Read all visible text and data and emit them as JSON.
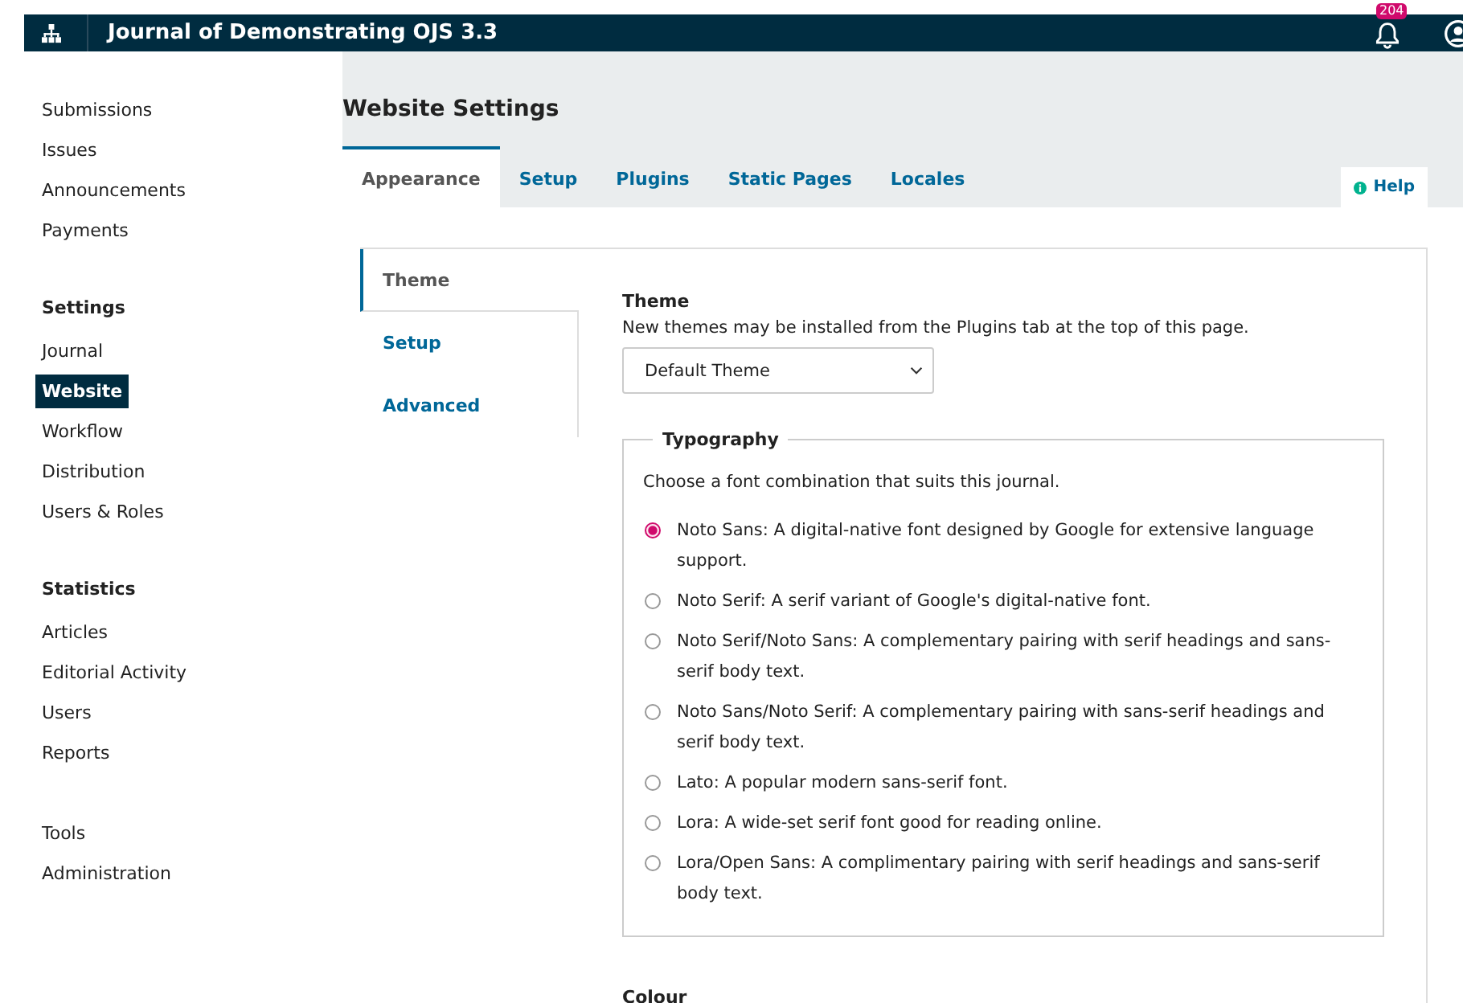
{
  "header": {
    "title": "Journal of Demonstrating OJS 3.3",
    "notification_count": "204"
  },
  "sidebar": {
    "sections": [
      {
        "items": [
          {
            "label": "Submissions",
            "selected": false
          },
          {
            "label": "Issues",
            "selected": false
          },
          {
            "label": "Announcements",
            "selected": false
          },
          {
            "label": "Payments",
            "selected": false
          }
        ]
      },
      {
        "heading": "Settings",
        "items": [
          {
            "label": "Journal",
            "selected": false
          },
          {
            "label": "Website",
            "selected": true
          },
          {
            "label": "Workflow",
            "selected": false
          },
          {
            "label": "Distribution",
            "selected": false
          },
          {
            "label": "Users & Roles",
            "selected": false
          }
        ]
      },
      {
        "heading": "Statistics",
        "items": [
          {
            "label": "Articles",
            "selected": false
          },
          {
            "label": "Editorial Activity",
            "selected": false
          },
          {
            "label": "Users",
            "selected": false
          },
          {
            "label": "Reports",
            "selected": false
          }
        ]
      },
      {
        "items": [
          {
            "label": "Tools",
            "selected": false
          },
          {
            "label": "Administration",
            "selected": false
          }
        ]
      }
    ]
  },
  "page_title": "Website Settings",
  "tabs": [
    {
      "label": "Appearance",
      "selected": true
    },
    {
      "label": "Setup",
      "selected": false
    },
    {
      "label": "Plugins",
      "selected": false
    },
    {
      "label": "Static Pages",
      "selected": false
    },
    {
      "label": "Locales",
      "selected": false
    }
  ],
  "help_button": "Help",
  "side_tabs": [
    {
      "label": "Theme",
      "selected": true
    },
    {
      "label": "Setup",
      "selected": false
    },
    {
      "label": "Advanced",
      "selected": false
    }
  ],
  "theme": {
    "label": "Theme",
    "description": "New themes may be installed from the Plugins tab at the top of this page.",
    "value": "Default Theme"
  },
  "typography": {
    "legend": "Typography",
    "description": "Choose a font combination that suits this journal.",
    "options": [
      {
        "label": "Noto Sans: A digital-native font designed by Google for extensive language support.",
        "selected": true
      },
      {
        "label": "Noto Serif: A serif variant of Google's digital-native font.",
        "selected": false
      },
      {
        "label": "Noto Serif/Noto Sans: A complementary pairing with serif headings and sans-serif body text.",
        "selected": false
      },
      {
        "label": "Noto Sans/Noto Serif: A complementary pairing with sans-serif headings and serif body text.",
        "selected": false
      },
      {
        "label": "Lato: A popular modern sans-serif font.",
        "selected": false
      },
      {
        "label": "Lora: A wide-set serif font good for reading online.",
        "selected": false
      },
      {
        "label": "Lora/Open Sans: A complimentary pairing with serif headings and sans-serif body text.",
        "selected": false
      }
    ]
  },
  "colour_label": "Colour"
}
